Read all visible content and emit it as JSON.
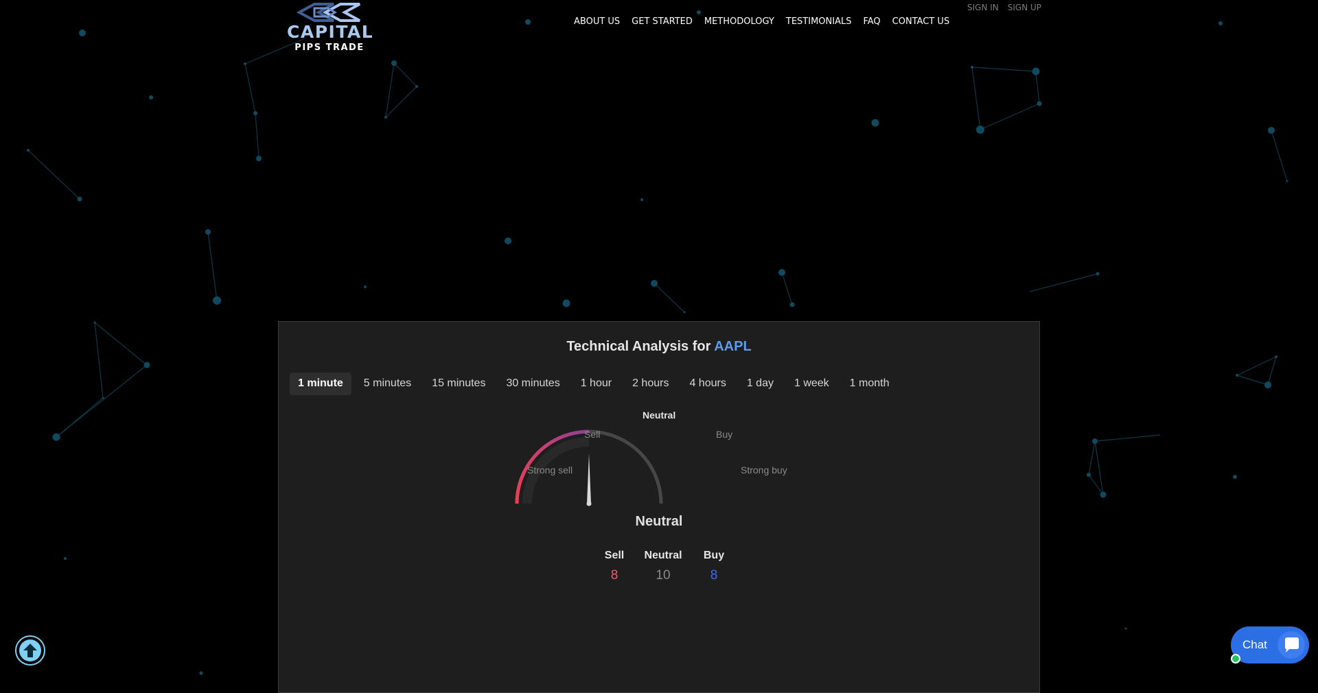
{
  "header": {
    "logo_title": "CAPITAL",
    "logo_subtitle": "PIPS TRADE",
    "nav": [
      "ABOUT US",
      "GET STARTED",
      "METHODOLOGY",
      "TESTIMONIALS",
      "FAQ",
      "CONTACT US"
    ],
    "auth": {
      "sign_in": "SIGN IN",
      "sign_up": "SIGN UP"
    }
  },
  "widget": {
    "title_prefix": "Technical Analysis for",
    "symbol": "AAPL",
    "intervals": [
      "1 minute",
      "5 minutes",
      "15 minutes",
      "30 minutes",
      "1 hour",
      "2 hours",
      "4 hours",
      "1 day",
      "1 week",
      "1 month"
    ],
    "active_interval": "1 minute",
    "gauge": {
      "labels": {
        "strong_sell": "Strong sell",
        "sell": "Sell",
        "neutral": "Neutral",
        "buy": "Buy",
        "strong_buy": "Strong buy"
      },
      "reading": "Neutral",
      "needle_fraction": 0.5
    },
    "counts": {
      "sell_label": "Sell",
      "sell_value": "8",
      "neutral_label": "Neutral",
      "neutral_value": "10",
      "buy_label": "Buy",
      "buy_value": "8"
    }
  },
  "colors": {
    "symbol": "#5b9cf2",
    "sell": "#f15b63",
    "neutral": "#8a8a8a",
    "buy": "#3b6cf0",
    "chat": "#2c6ee4",
    "scroll_top": "#7fd0f4"
  },
  "chat": {
    "label": "Chat"
  },
  "icons": {
    "scroll_top": "arrow-up-circle-icon",
    "chat": "chat-bubble-icon"
  }
}
